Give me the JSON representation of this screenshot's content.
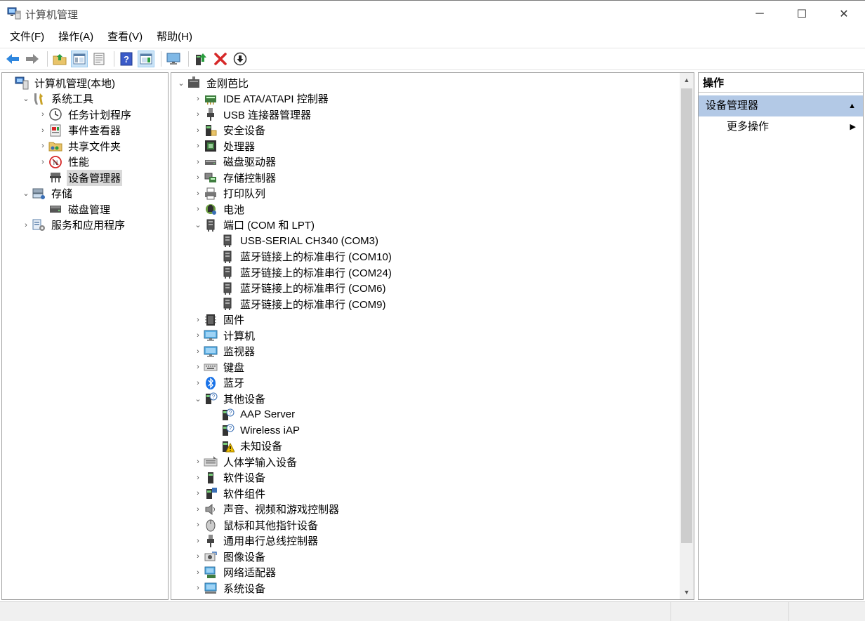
{
  "window": {
    "title": "计算机管理",
    "minimize_glyph": "─",
    "maximize_glyph": "☐",
    "close_glyph": "✕"
  },
  "menu": [
    "文件(F)",
    "操作(A)",
    "查看(V)",
    "帮助(H)"
  ],
  "toolbar": [
    "back-icon",
    "forward-icon",
    "up-folder-icon",
    "show-hide-tree-icon",
    "properties-icon",
    "help-icon",
    "show-hide-action-icon",
    "monitor-icon",
    "update-driver-icon",
    "uninstall-icon",
    "disable-device-icon"
  ],
  "nav_tree": [
    {
      "label": "计算机管理(本地)",
      "icon": "computer-management-icon",
      "level": 0,
      "arrow": ""
    },
    {
      "label": "系统工具",
      "icon": "tools-icon",
      "level": 1,
      "arrow": "⌄"
    },
    {
      "label": "任务计划程序",
      "icon": "clock-icon",
      "level": 2,
      "arrow": "›"
    },
    {
      "label": "事件查看器",
      "icon": "event-viewer-icon",
      "level": 2,
      "arrow": "›"
    },
    {
      "label": "共享文件夹",
      "icon": "shared-folder-icon",
      "level": 2,
      "arrow": "›"
    },
    {
      "label": "性能",
      "icon": "performance-icon",
      "level": 2,
      "arrow": "›"
    },
    {
      "label": "设备管理器",
      "icon": "device-manager-icon",
      "level": 2,
      "arrow": "",
      "selected": true
    },
    {
      "label": "存储",
      "icon": "storage-icon",
      "level": 1,
      "arrow": "⌄"
    },
    {
      "label": "磁盘管理",
      "icon": "disk-management-icon",
      "level": 2,
      "arrow": ""
    },
    {
      "label": "服务和应用程序",
      "icon": "services-icon",
      "level": 1,
      "arrow": "›"
    }
  ],
  "device_tree": [
    {
      "label": "金刚芭比",
      "icon": "computer-root-icon",
      "level": 0,
      "arrow": "⌄"
    },
    {
      "label": "IDE ATA/ATAPI 控制器",
      "icon": "ide-controller-icon",
      "level": 1,
      "arrow": "›"
    },
    {
      "label": "USB 连接器管理器",
      "icon": "usb-connector-icon",
      "level": 1,
      "arrow": "›"
    },
    {
      "label": "安全设备",
      "icon": "security-device-icon",
      "level": 1,
      "arrow": "›"
    },
    {
      "label": "处理器",
      "icon": "processor-icon",
      "level": 1,
      "arrow": "›"
    },
    {
      "label": "磁盘驱动器",
      "icon": "disk-drive-icon",
      "level": 1,
      "arrow": "›"
    },
    {
      "label": "存储控制器",
      "icon": "storage-controller-icon",
      "level": 1,
      "arrow": "›"
    },
    {
      "label": "打印队列",
      "icon": "printer-icon",
      "level": 1,
      "arrow": "›"
    },
    {
      "label": "电池",
      "icon": "battery-icon",
      "level": 1,
      "arrow": "›"
    },
    {
      "label": "端口 (COM 和 LPT)",
      "icon": "port-icon",
      "level": 1,
      "arrow": "⌄"
    },
    {
      "label": "USB-SERIAL CH340 (COM3)",
      "icon": "port-icon",
      "level": 2,
      "arrow": ""
    },
    {
      "label": "蓝牙链接上的标准串行 (COM10)",
      "icon": "port-icon",
      "level": 2,
      "arrow": ""
    },
    {
      "label": "蓝牙链接上的标准串行 (COM24)",
      "icon": "port-icon",
      "level": 2,
      "arrow": ""
    },
    {
      "label": "蓝牙链接上的标准串行 (COM6)",
      "icon": "port-icon",
      "level": 2,
      "arrow": ""
    },
    {
      "label": "蓝牙链接上的标准串行 (COM9)",
      "icon": "port-icon",
      "level": 2,
      "arrow": ""
    },
    {
      "label": "固件",
      "icon": "firmware-icon",
      "level": 1,
      "arrow": "›"
    },
    {
      "label": "计算机",
      "icon": "monitor-icon",
      "level": 1,
      "arrow": "›"
    },
    {
      "label": "监视器",
      "icon": "monitor-icon",
      "level": 1,
      "arrow": "›"
    },
    {
      "label": "键盘",
      "icon": "keyboard-icon",
      "level": 1,
      "arrow": "›"
    },
    {
      "label": "蓝牙",
      "icon": "bluetooth-icon",
      "level": 1,
      "arrow": "›"
    },
    {
      "label": "其他设备",
      "icon": "unknown-device-icon",
      "level": 1,
      "arrow": "⌄"
    },
    {
      "label": "AAP Server",
      "icon": "unknown-device-icon",
      "level": 2,
      "arrow": ""
    },
    {
      "label": "Wireless iAP",
      "icon": "unknown-device-icon",
      "level": 2,
      "arrow": ""
    },
    {
      "label": "未知设备",
      "icon": "warning-device-icon",
      "level": 2,
      "arrow": ""
    },
    {
      "label": "人体学输入设备",
      "icon": "hid-icon",
      "level": 1,
      "arrow": "›"
    },
    {
      "label": "软件设备",
      "icon": "software-device-icon",
      "level": 1,
      "arrow": "›"
    },
    {
      "label": "软件组件",
      "icon": "software-component-icon",
      "level": 1,
      "arrow": "›"
    },
    {
      "label": "声音、视频和游戏控制器",
      "icon": "speaker-icon",
      "level": 1,
      "arrow": "›"
    },
    {
      "label": "鼠标和其他指针设备",
      "icon": "mouse-icon",
      "level": 1,
      "arrow": "›"
    },
    {
      "label": "通用串行总线控制器",
      "icon": "usb-controller-icon",
      "level": 1,
      "arrow": "›"
    },
    {
      "label": "图像设备",
      "icon": "camera-icon",
      "level": 1,
      "arrow": "›"
    },
    {
      "label": "网络适配器",
      "icon": "network-adapter-icon",
      "level": 1,
      "arrow": "›"
    },
    {
      "label": "系统设备",
      "icon": "system-device-icon",
      "level": 1,
      "arrow": "›"
    }
  ],
  "actions": {
    "header": "操作",
    "section": "设备管理器",
    "section_caret": "▲",
    "item": "更多操作",
    "item_caret": "▶"
  },
  "scrollbar": {
    "up": "▲",
    "down": "▼"
  }
}
